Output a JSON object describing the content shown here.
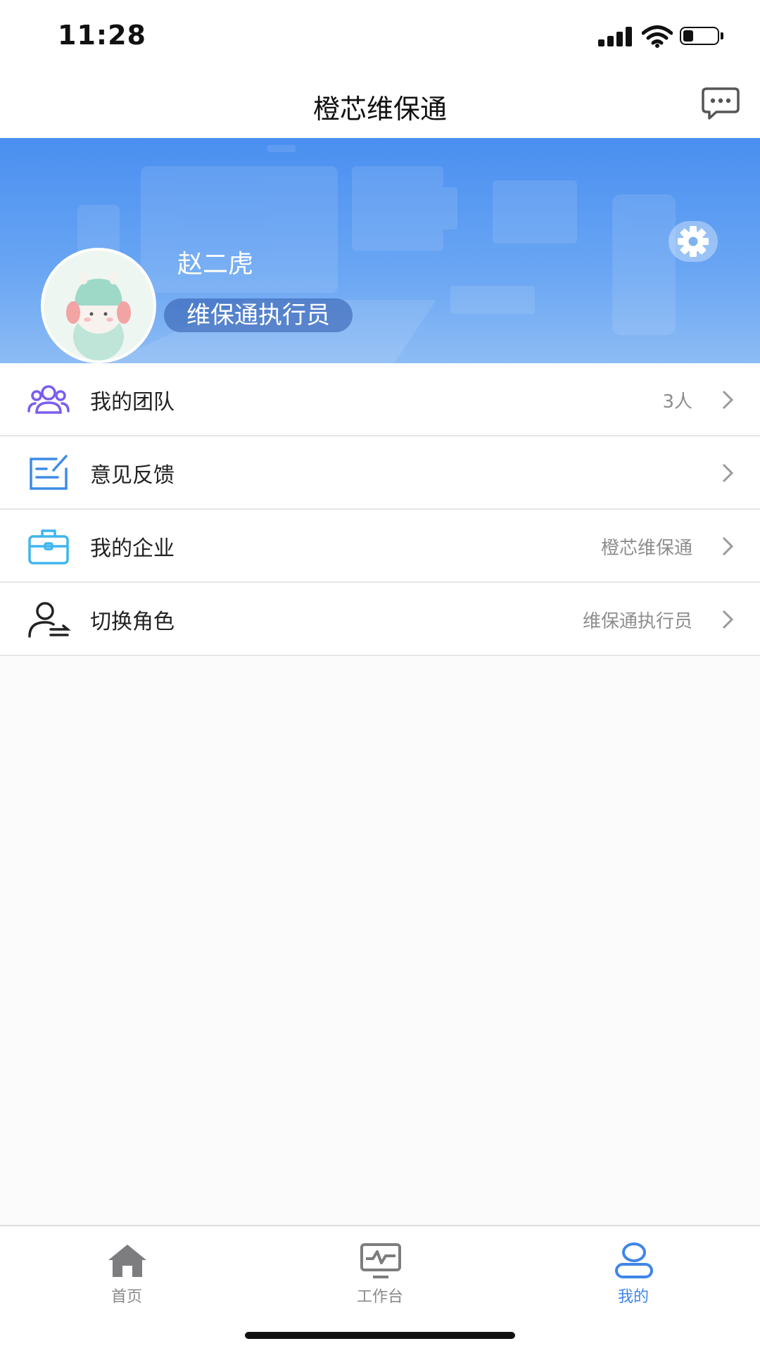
{
  "status_bar": {
    "time": "11:28"
  },
  "nav": {
    "title": "橙芯维保通"
  },
  "profile": {
    "name": "赵二虎",
    "role": "维保通执行员"
  },
  "menu": {
    "items": [
      {
        "label": "我的团队",
        "value": "3人",
        "icon": "team-icon",
        "icon_color": "#7a5cf0"
      },
      {
        "label": "意见反馈",
        "value": "",
        "icon": "feedback-icon",
        "icon_color": "#3d8be8"
      },
      {
        "label": "我的企业",
        "value": "橙芯维保通",
        "icon": "briefcase-icon",
        "icon_color": "#3fb6ee"
      },
      {
        "label": "切换角色",
        "value": "维保通执行员",
        "icon": "switch-role-icon",
        "icon_color": "#222222"
      }
    ]
  },
  "tabs": [
    {
      "label": "首页",
      "icon": "home-icon",
      "active": false
    },
    {
      "label": "工作台",
      "icon": "monitor-icon",
      "active": false
    },
    {
      "label": "我的",
      "icon": "profile-icon",
      "active": true
    }
  ],
  "colors": {
    "accent": "#3f86e8",
    "banner": "#4a8ff0",
    "inactive_tab": "#8a8a8c"
  }
}
